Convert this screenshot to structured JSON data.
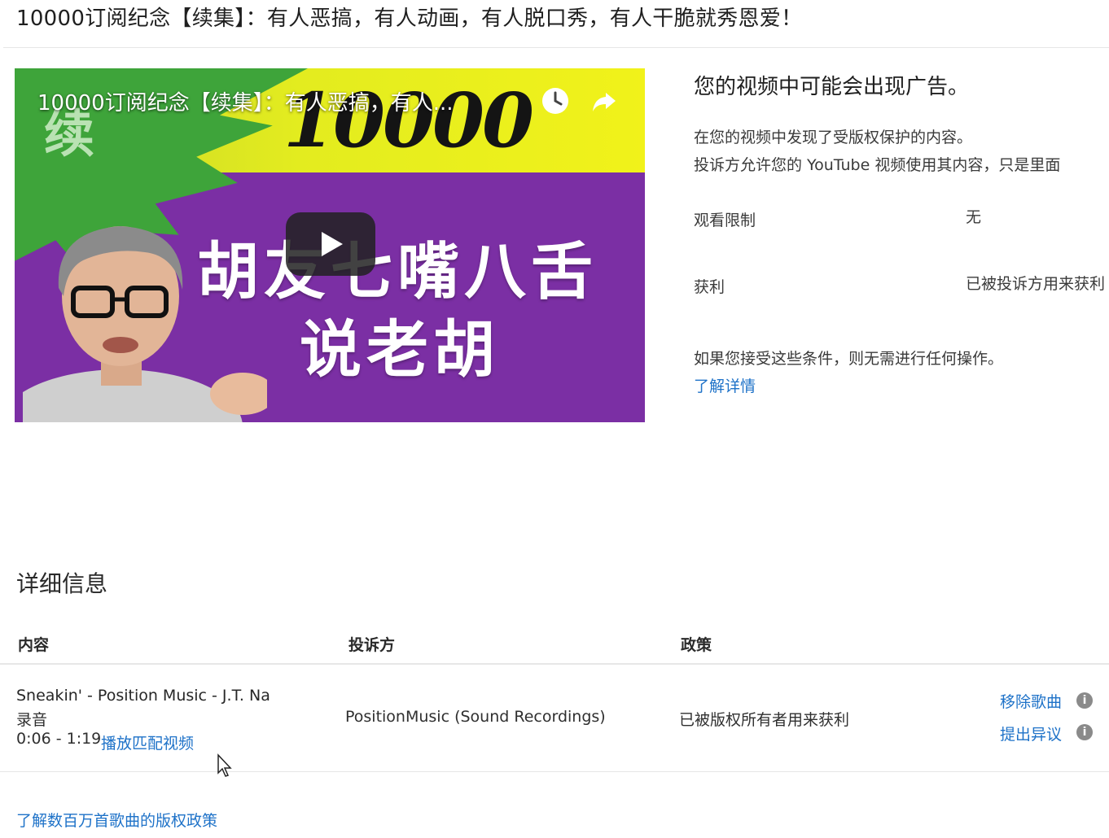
{
  "page": {
    "title": "10000订阅纪念【续集】：有人恶搞，有人动画，有人脱口秀，有人干脆就秀恩爱！"
  },
  "video": {
    "overlay_title": "10000订阅纪念【续集】：有人恶搞，有人...",
    "thumb_char": "续",
    "thumb_number": "10000",
    "thumb_line1": "胡友七嘴八舌",
    "thumb_line2": "说老胡",
    "play_icon": "play-icon",
    "clock_icon": "clock-icon",
    "share_icon": "share-icon"
  },
  "ad_panel": {
    "heading": "您的视频中可能会出现广告。",
    "desc1": "在您的视频中发现了受版权保护的内容。",
    "desc2": "投诉方允许您的 YouTube 视频使用其内容，只是里面",
    "rows": [
      {
        "label": "观看限制",
        "value": "无"
      },
      {
        "label": "获利",
        "value": "已被投诉方用来获利"
      }
    ],
    "accept_note": "如果您接受这些条件，则无需进行任何操作。",
    "learn_more": "了解详情"
  },
  "details": {
    "heading": "详细信息",
    "columns": [
      "内容",
      "投诉方",
      "政策"
    ],
    "row": {
      "song": "Sneakin' - Position Music - J.T. Na",
      "type": "录音",
      "time": "0:06 - 1:19",
      "play_match": "播放匹配视频",
      "claimant": "PositionMusic (Sound Recordings)",
      "policy": "已被版权所有者用来获利",
      "remove_song": "移除歌曲",
      "dispute": "提出异议"
    },
    "footer_link": "了解数百万首歌曲的版权政策"
  },
  "colors": {
    "link": "#1e72c8",
    "thumb_purple": "#7b2fa4",
    "thumb_yellow": "#f1f21a",
    "thumb_green": "#3ea43a"
  }
}
